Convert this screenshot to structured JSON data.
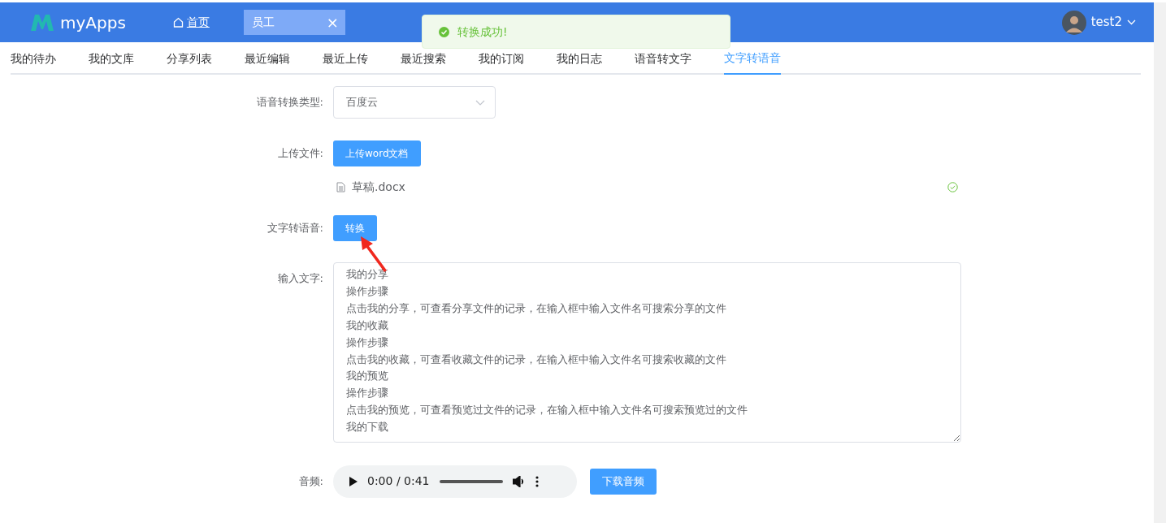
{
  "header": {
    "logo": "myApps",
    "home": "首页",
    "open_tab": {
      "label": "员工",
      "close": "×"
    },
    "user": "test2"
  },
  "toast": {
    "kind": "success",
    "text": "转换成功!"
  },
  "tabs": [
    {
      "label": "我的待办",
      "selected": false
    },
    {
      "label": "我的文库",
      "selected": false
    },
    {
      "label": "分享列表",
      "selected": false
    },
    {
      "label": "最近编辑",
      "selected": false
    },
    {
      "label": "最近上传",
      "selected": false
    },
    {
      "label": "最近搜索",
      "selected": false
    },
    {
      "label": "我的订阅",
      "selected": false
    },
    {
      "label": "我的日志",
      "selected": false
    },
    {
      "label": "语音转文字",
      "selected": false
    },
    {
      "label": "文字转语音",
      "selected": true
    }
  ],
  "form": {
    "type_label": "语音转换类型:",
    "type_value": "百度云",
    "upload_label": "上传文件:",
    "upload_button": "上传word文档",
    "file": {
      "name": "草稿.docx",
      "done": true
    },
    "convert_label": "文字转语音:",
    "convert_button": "转换",
    "input_label": "输入文字:",
    "input_lines": [
      "我的分享",
      "操作步骤",
      "点击我的分享，可查看分享文件的记录，在输入框中输入文件名可搜索分享的文件",
      "我的收藏",
      "操作步骤",
      "点击我的收藏，可查看收藏文件的记录，在输入框中输入文件名可搜索收藏的文件",
      "我的预览",
      "操作步骤",
      "点击我的预览，可查看预览过文件的记录，在输入框中输入文件名可搜索预览过的文件",
      "我的下载"
    ],
    "audio_label": "音频:",
    "audio_time": "0:00 / 0:41",
    "download_button": "下载音频"
  }
}
